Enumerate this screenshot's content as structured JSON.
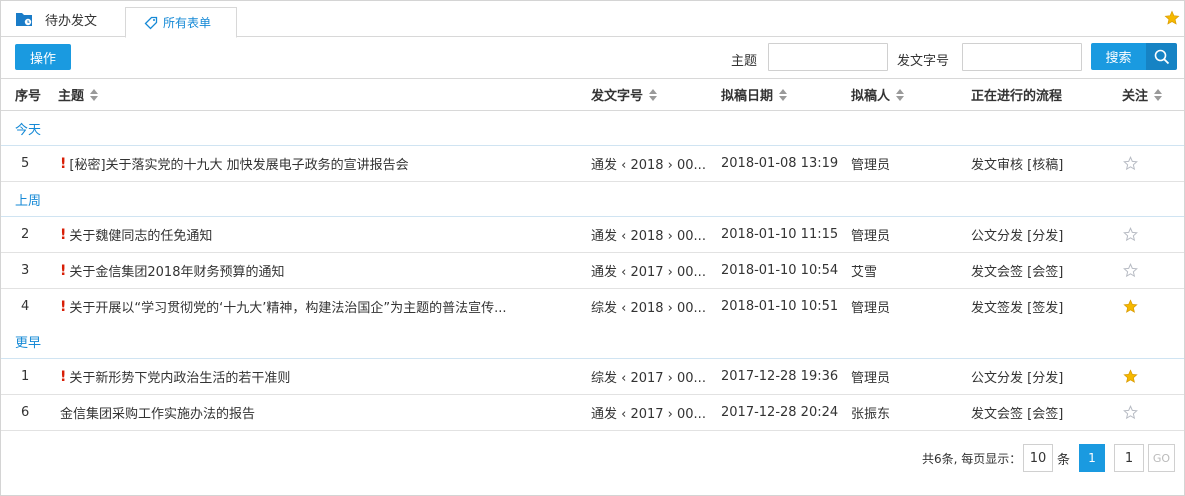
{
  "tabs": [
    {
      "label": "待办发文"
    },
    {
      "label": "所有表单"
    }
  ],
  "toolbar": {
    "op_label": "操作",
    "subject_label": "主题",
    "docno_label": "发文字号",
    "search_label": "搜索",
    "subject_value": "",
    "docno_value": ""
  },
  "columns": {
    "seq": "序号",
    "subject": "主题",
    "docno": "发文字号",
    "date": "拟稿日期",
    "drafter": "拟稿人",
    "flow": "正在进行的流程",
    "follow": "关注"
  },
  "groups": [
    {
      "label": "今天",
      "rows": [
        {
          "seq": "5",
          "urgent": true,
          "subject": "[秘密]关于落实党的十九大 加快发展电子政务的宣讲报告会",
          "docno": "通发 ‹ 2018 › 00...",
          "date": "2018-01-08 13:19",
          "drafter": "管理员",
          "flow": "发文审核 [核稿]",
          "followed": false
        }
      ]
    },
    {
      "label": "上周",
      "rows": [
        {
          "seq": "2",
          "urgent": true,
          "subject": "关于魏健同志的任免通知",
          "docno": "通发 ‹ 2018 › 00...",
          "date": "2018-01-10 11:15",
          "drafter": "管理员",
          "flow": "公文分发 [分发]",
          "followed": false
        },
        {
          "seq": "3",
          "urgent": true,
          "subject": "关于金信集团2018年财务预算的通知",
          "docno": "通发 ‹ 2017 › 00...",
          "date": "2018-01-10 10:54",
          "drafter": "艾雪",
          "flow": "发文会签 [会签]",
          "followed": false
        },
        {
          "seq": "4",
          "urgent": true,
          "subject": "关于开展以“学习贯彻党的‘十九大’精神，构建法治国企”为主题的普法宣传...",
          "docno": "综发 ‹ 2018 › 00...",
          "date": "2018-01-10 10:51",
          "drafter": "管理员",
          "flow": "发文签发 [签发]",
          "followed": true
        }
      ]
    },
    {
      "label": "更早",
      "rows": [
        {
          "seq": "1",
          "urgent": true,
          "subject": "关于新形势下党内政治生活的若干准则",
          "docno": "综发 ‹ 2017 › 00...",
          "date": "2017-12-28 19:36",
          "drafter": "管理员",
          "flow": "公文分发 [分发]",
          "followed": true
        },
        {
          "seq": "6",
          "urgent": false,
          "subject": "金信集团采购工作实施办法的报告",
          "docno": "通发 ‹ 2017 › 00...",
          "date": "2017-12-28 20:24",
          "drafter": "张振东",
          "flow": "发文会签 [会签]",
          "followed": false
        }
      ]
    }
  ],
  "pager": {
    "summary": "共6条, 每页显示：",
    "page_size": "10",
    "unit": "条",
    "current_page": "1",
    "goto_value": "1",
    "go_label": "GO"
  },
  "colors": {
    "accent": "#1a9ae0",
    "urgent": "#d81e06",
    "star_on": "#f5b800",
    "star_off": "#b8bcc4"
  }
}
